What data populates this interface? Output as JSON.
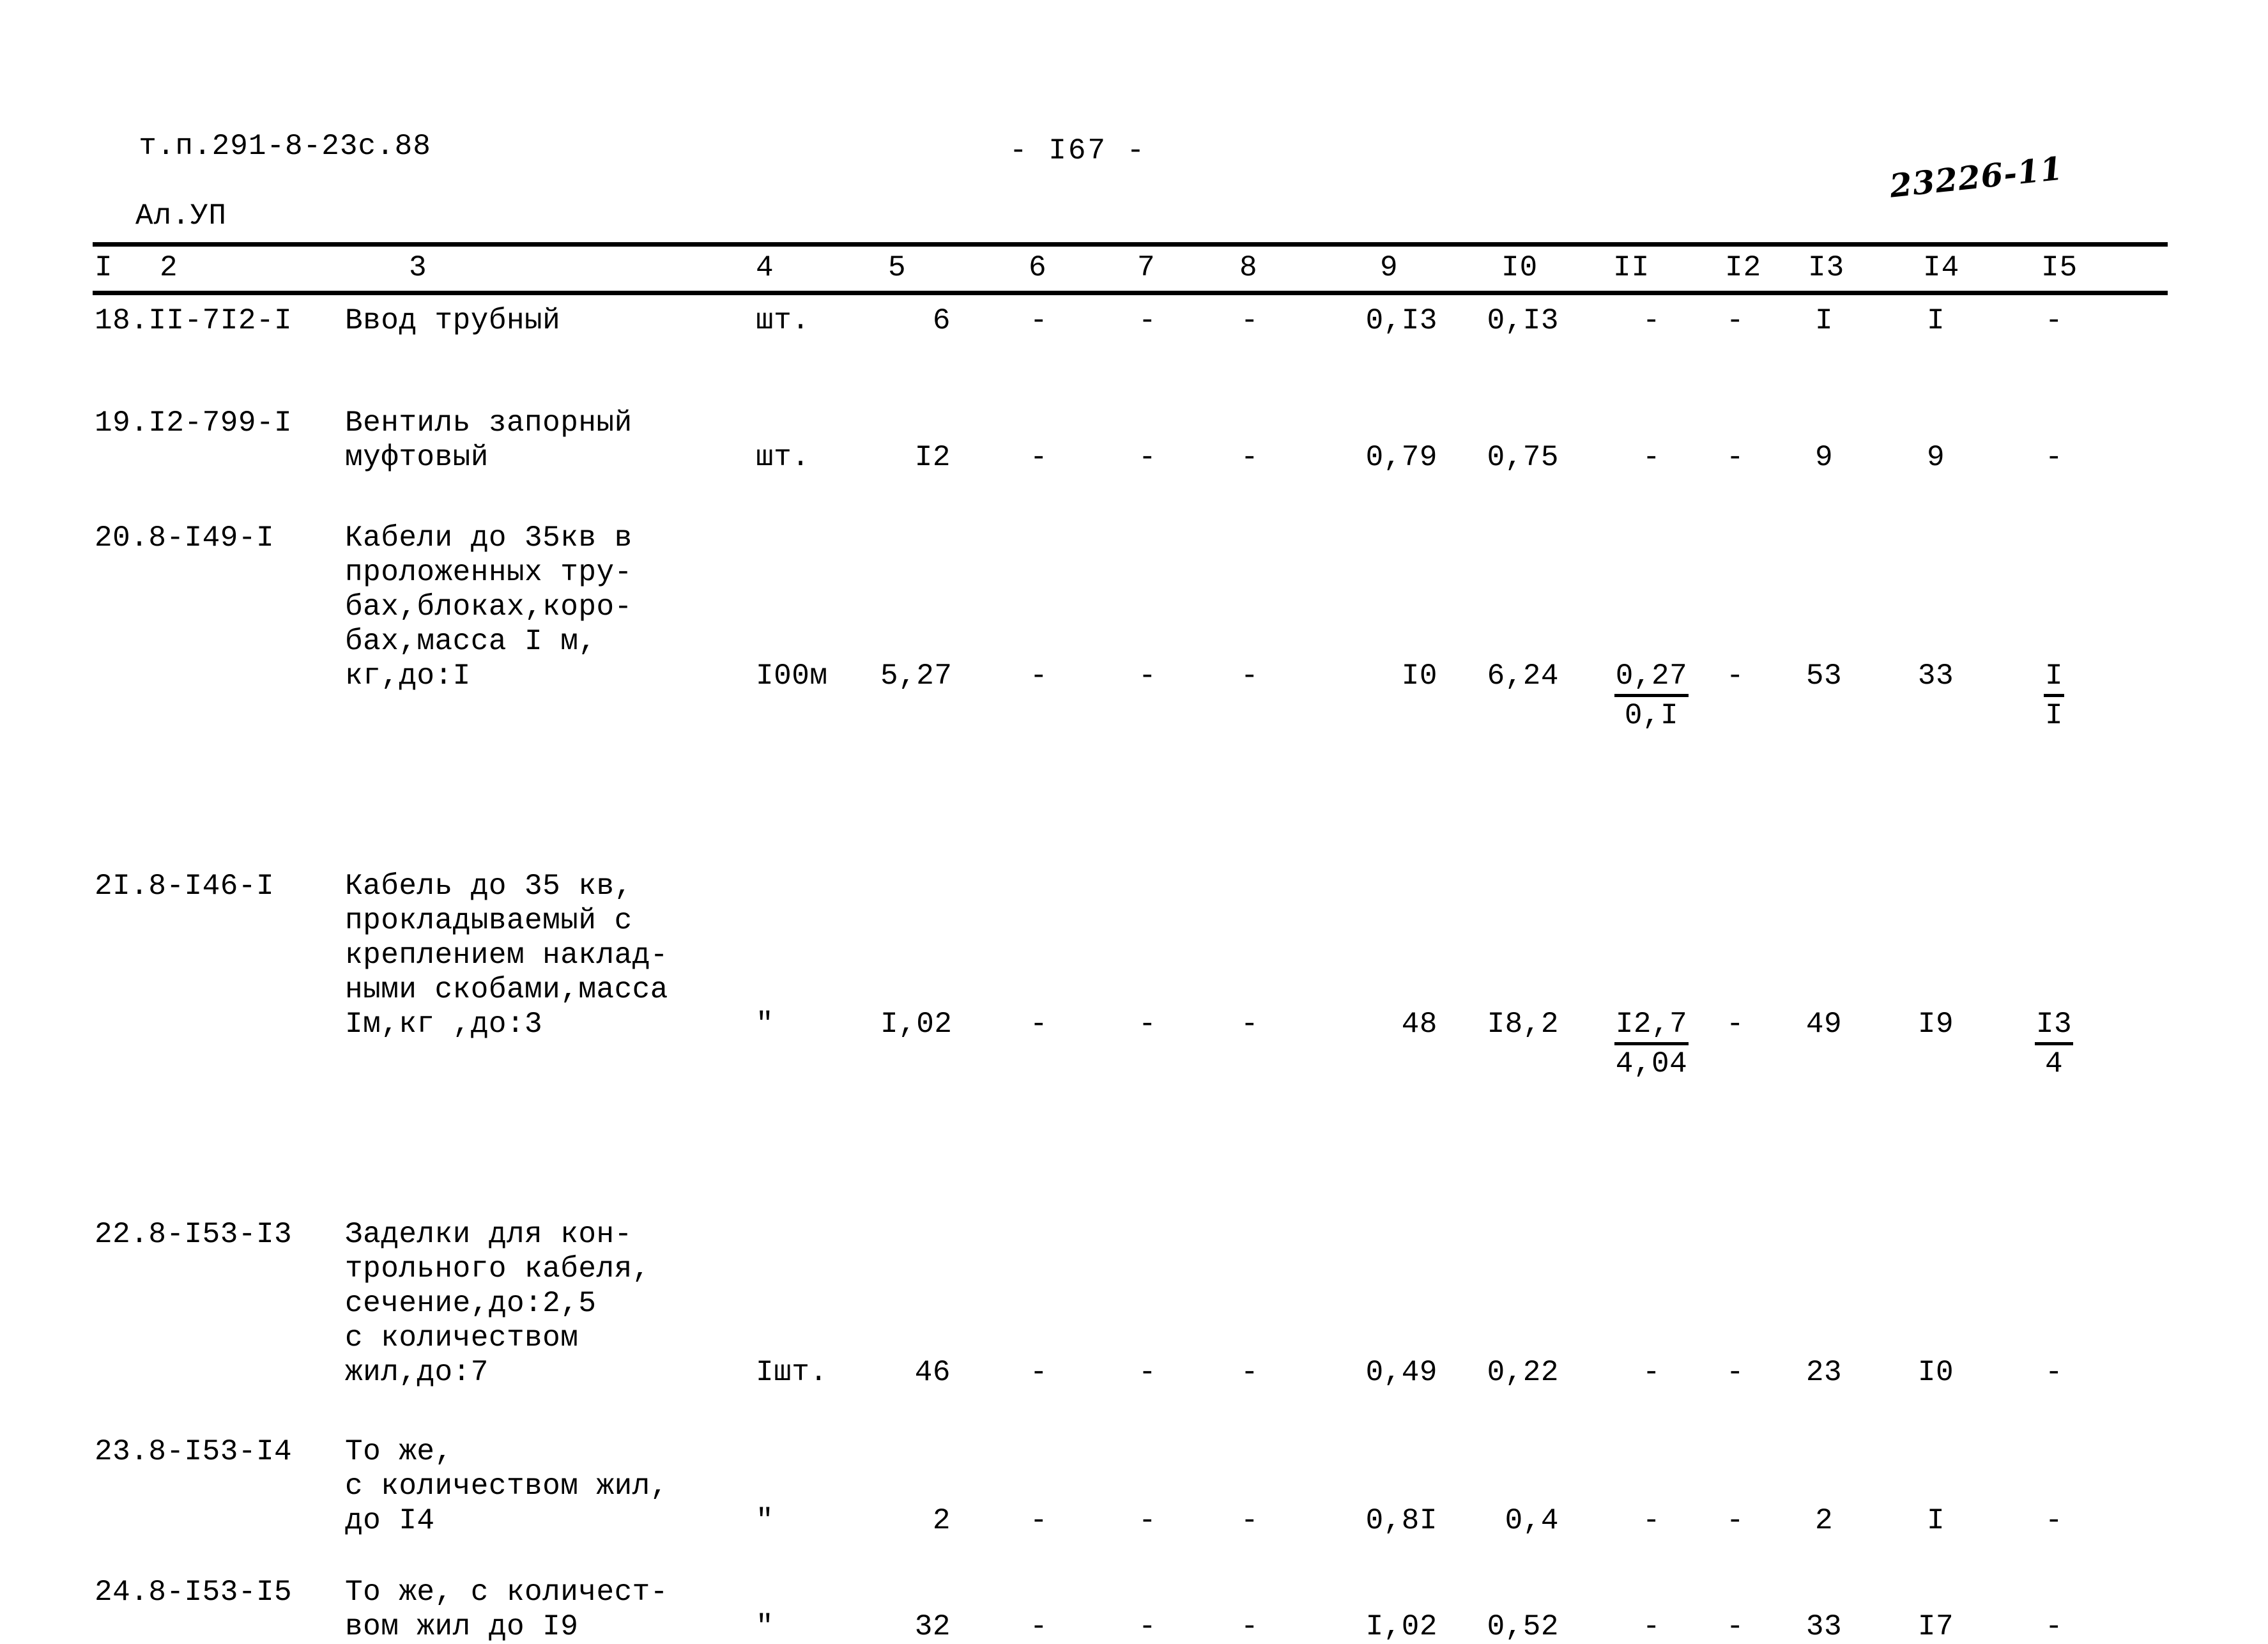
{
  "header": {
    "doc_code_line1": "т.п.291-8-23с.88",
    "doc_code_line2": "Ал.УП",
    "page_number": "- I67 -",
    "stamp_number": "23226-11"
  },
  "table": {
    "column_numbers": [
      "I",
      "2",
      "3",
      "4",
      "5",
      "6",
      "7",
      "8",
      "9",
      "I0",
      "II",
      "I2",
      "I3",
      "I4",
      "I5"
    ],
    "rows": [
      {
        "code": "18.II-7I2-I",
        "desc": [
          "Ввод трубный"
        ],
        "desc_baseline": 0,
        "c4": "шт.",
        "c5": "6",
        "c6": "-",
        "c7": "-",
        "c8": "-",
        "c9": "0,I3",
        "c10": "0,I3",
        "c11": "-",
        "c12": "-",
        "c13": "I",
        "c14": "I",
        "c15": "-"
      },
      {
        "code": "19.I2-799-I",
        "desc": [
          "Вентиль запорный",
          "муфтовый"
        ],
        "desc_baseline": 1,
        "c4": "шт.",
        "c5": "I2",
        "c6": "-",
        "c7": "-",
        "c8": "-",
        "c9": "0,79",
        "c10": "0,75",
        "c11": "-",
        "c12": "-",
        "c13": "9",
        "c14": "9",
        "c15": "-"
      },
      {
        "code": "20.8-I49-I",
        "desc": [
          "Кабели до 35кв в",
          "проложенных тру-",
          "бах,блоках,коро-",
          "бах,масса I м,",
          "кг,до:I"
        ],
        "desc_baseline": 4,
        "c4": "I00м",
        "c5": "5,27",
        "c6": "-",
        "c7": "-",
        "c8": "-",
        "c9": "I0",
        "c10": "6,24",
        "c11_num": "0,27",
        "c11_den": "0,I",
        "c12": "-",
        "c13": "53",
        "c14": "33",
        "c15_num": "I",
        "c15_den": "I"
      },
      {
        "code": "2I.8-I46-I",
        "desc": [
          "Кабель до 35 кв,",
          "прокладываемый с",
          "креплением наклад-",
          "ными скобами,масса",
          "Iм,кг ,до:3"
        ],
        "desc_baseline": 4,
        "c4": "\"",
        "c5": "I,02",
        "c6": "-",
        "c7": "-",
        "c8": "-",
        "c9": "48",
        "c10": "I8,2",
        "c11_num": "I2,7",
        "c11_den": "4,04",
        "c12": "-",
        "c13": "49",
        "c14": "I9",
        "c15_num": "I3",
        "c15_den": "4"
      },
      {
        "code": "22.8-I53-I3",
        "desc": [
          "Заделки для кон-",
          "трольного кабеля,",
          "сечение,до:2,5",
          "с количеством",
          "жил,до:7"
        ],
        "desc_baseline": 4,
        "c4": "Iшт.",
        "c5": "46",
        "c6": "-",
        "c7": "-",
        "c8": "-",
        "c9": "0,49",
        "c10": "0,22",
        "c11": "-",
        "c12": "-",
        "c13": "23",
        "c14": "I0",
        "c15": "-"
      },
      {
        "code": "23.8-I53-I4",
        "desc": [
          "То же,",
          "с количеством жил,",
          "до I4"
        ],
        "desc_baseline": 2,
        "c4": "\"",
        "c5": "2",
        "c6": "-",
        "c7": "-",
        "c8": "-",
        "c9": "0,8I",
        "c10": "0,4",
        "c11": "-",
        "c12": "-",
        "c13": "2",
        "c14": "I",
        "c15": "-"
      },
      {
        "code": "24.8-I53-I5",
        "desc": [
          "То же, с количест-",
          "вом жил до I9"
        ],
        "desc_baseline": 1,
        "c4": "\"",
        "c5": "32",
        "c6": "-",
        "c7": "-",
        "c8": "-",
        "c9": "I,02",
        "c10": "0,52",
        "c11": "-",
        "c12": "-",
        "c13": "33",
        "c14": "I7",
        "c15": "-"
      }
    ]
  },
  "layout": {
    "column_x": [
      148,
      250,
      640,
      1183,
      1390,
      1610,
      1780,
      1940,
      2160,
      2350,
      2525,
      2700,
      2830,
      3010,
      3195
    ],
    "row_top": [
      20,
      180,
      360,
      905,
      1450,
      1790,
      2010
    ],
    "row_line_height": 54
  }
}
